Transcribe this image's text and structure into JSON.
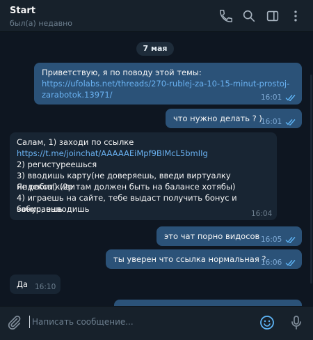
{
  "header": {
    "title": "Start",
    "status": "был(а) недавно"
  },
  "date": "7 мая",
  "messages": [
    {
      "dir": "out",
      "text": "Приветствую, я по поводу этой темы:",
      "link_lines": [
        "https://ufolabs.net/threads/270-rublej-za-10-15-minut-prostoj-",
        "zarabotok.13971/"
      ],
      "time": "16:01",
      "read": true
    },
    {
      "dir": "out",
      "text": "что нужно делать ? )",
      "time": "16:01",
      "read": true
    },
    {
      "dir": "in",
      "lines": [
        "Салам, 1) заходи по ссылке"
      ],
      "link": "https://t.me/joinchat/AAAAAEiMpf9BIMcL5bmIIg",
      "rest": [
        "2) регистуреешься",
        "3) вводишь карту(не доверяешь, введи виртуалку Яндекса(киви",
        "не робит) (2р там должен быть на балансе хотябы)",
        "4) играешь на сайте, тебе выдаст получить бонус и забираешь",
        "бонус, выводишь"
      ],
      "time": "16:04"
    },
    {
      "dir": "out",
      "text": "это чат порно видосов",
      "time": "16:05",
      "read": true
    },
    {
      "dir": "out",
      "text": "ты уверен что ссылка нормальная ?",
      "time": "16:06",
      "read": true
    },
    {
      "dir": "in",
      "text": "Да",
      "time": "16:10"
    }
  ],
  "composer": {
    "placeholder": "Написать сообщение..."
  },
  "colors": {
    "bg": "#0e1621",
    "panel": "#17212b",
    "out_bubble": "#2b5278",
    "in_bubble": "#182533",
    "link": "#6ab2f2",
    "accent": "#5eb5f7"
  },
  "icons": [
    "phone-icon",
    "search-icon",
    "sidebar-toggle-icon",
    "more-vertical-icon",
    "attach-icon",
    "emoji-icon",
    "microphone-icon"
  ]
}
